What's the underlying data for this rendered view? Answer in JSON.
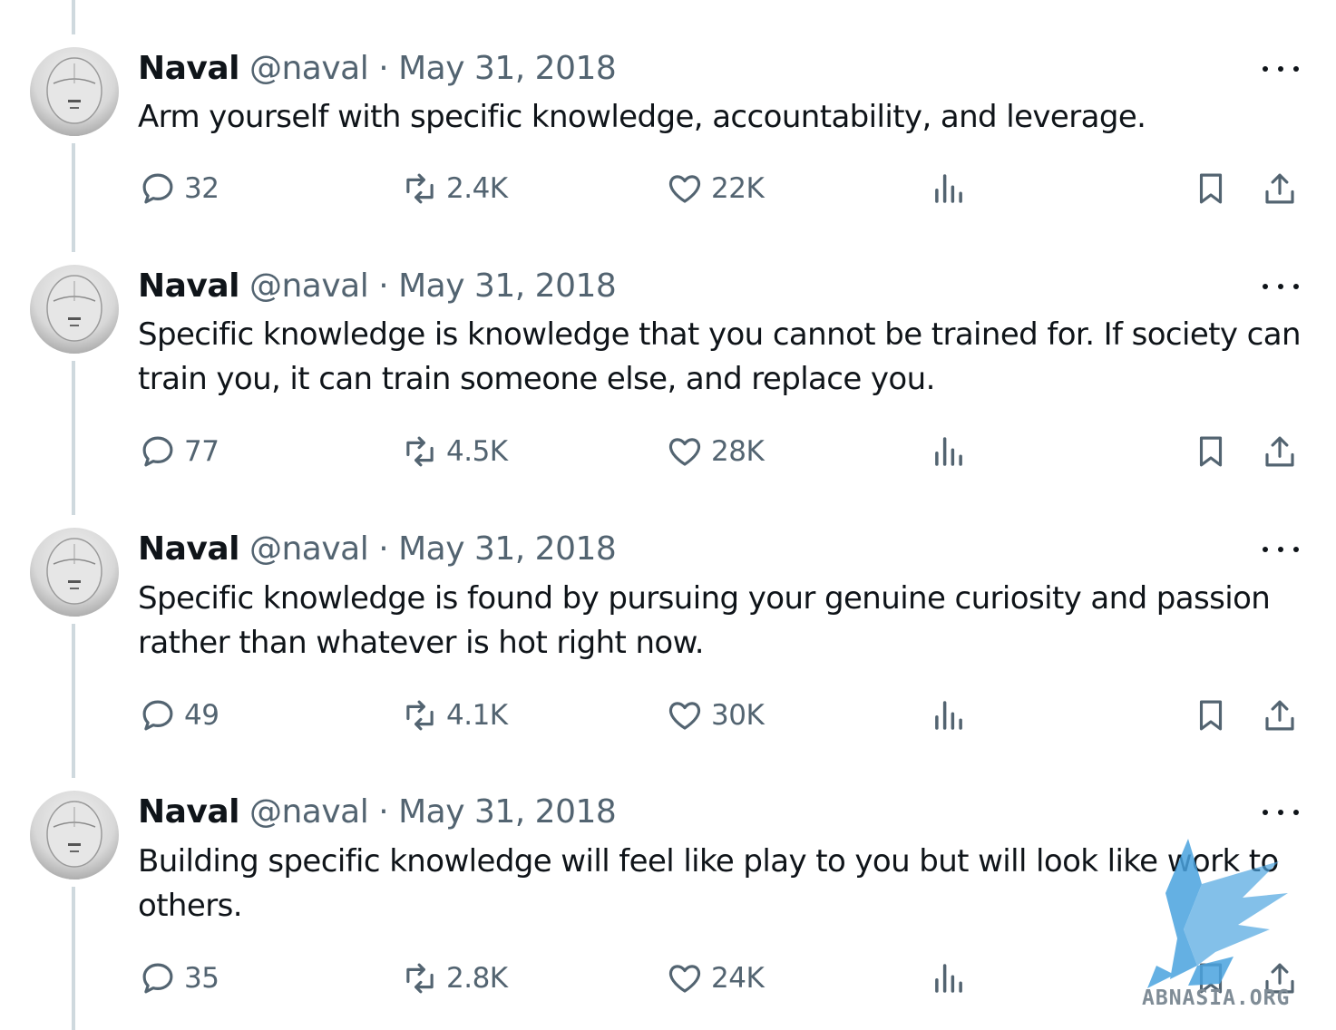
{
  "tweets": [
    {
      "name": "Naval",
      "handle": "@naval",
      "sep": "·",
      "date": "May 31, 2018",
      "text": "Arm yourself with specific knowledge, accountability, and leverage.",
      "replies": "32",
      "reposts": "2.4K",
      "likes": "22K"
    },
    {
      "name": "Naval",
      "handle": "@naval",
      "sep": "·",
      "date": "May 31, 2018",
      "text": "Specific knowledge is knowledge that you cannot be trained for. If society can train you, it can train someone else, and replace you.",
      "replies": "77",
      "reposts": "4.5K",
      "likes": "28K"
    },
    {
      "name": "Naval",
      "handle": "@naval",
      "sep": "·",
      "date": "May 31, 2018",
      "text": "Specific knowledge is found by pursuing your genuine curiosity and passion rather than whatever is hot right now.",
      "replies": "49",
      "reposts": "4.1K",
      "likes": "30K"
    },
    {
      "name": "Naval",
      "handle": "@naval",
      "sep": "·",
      "date": "May 31, 2018",
      "text": "Building specific knowledge will feel like play to you but will look like work to others.",
      "replies": "35",
      "reposts": "2.8K",
      "likes": "24K"
    }
  ],
  "watermark": {
    "text": "ABNASIA.ORG"
  },
  "colors": {
    "text": "#0f1419",
    "muted": "#536471",
    "thread_line": "#cfd9de",
    "watermark": "#4aa3df"
  }
}
